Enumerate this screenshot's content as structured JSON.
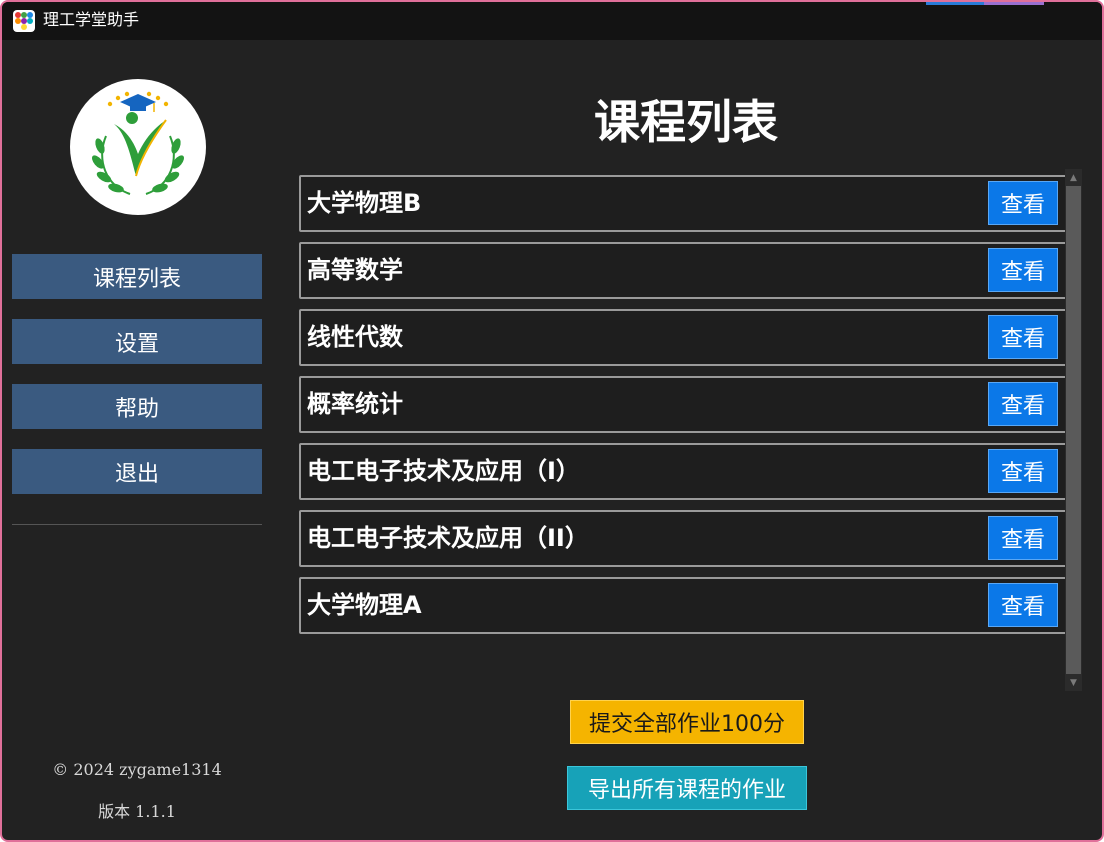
{
  "window": {
    "title": "理工学堂助手"
  },
  "sidebar": {
    "logo_icon": "school-logo-icon",
    "items": [
      {
        "label": "课程列表"
      },
      {
        "label": "设置"
      },
      {
        "label": "帮助"
      },
      {
        "label": "退出"
      }
    ],
    "copyright": "© 2024 zygame1314",
    "version": "版本 1.1.1"
  },
  "main": {
    "title": "课程列表",
    "view_label": "查看",
    "courses": [
      {
        "name": "大学物理B"
      },
      {
        "name": "高等数学"
      },
      {
        "name": "线性代数"
      },
      {
        "name": "概率统计"
      },
      {
        "name": "电工电子技术及应用（I）"
      },
      {
        "name": "电工电子技术及应用（II）"
      },
      {
        "name": "大学物理A"
      }
    ],
    "submit_all_label": "提交全部作业100分",
    "export_all_label": "导出所有课程的作业"
  },
  "colors": {
    "background": "#222222",
    "nav_button": "#3a5a80",
    "view_button": "#0b78e8",
    "submit_button": "#f5b400",
    "export_button": "#17a2b8",
    "window_border": "#e0709a"
  }
}
